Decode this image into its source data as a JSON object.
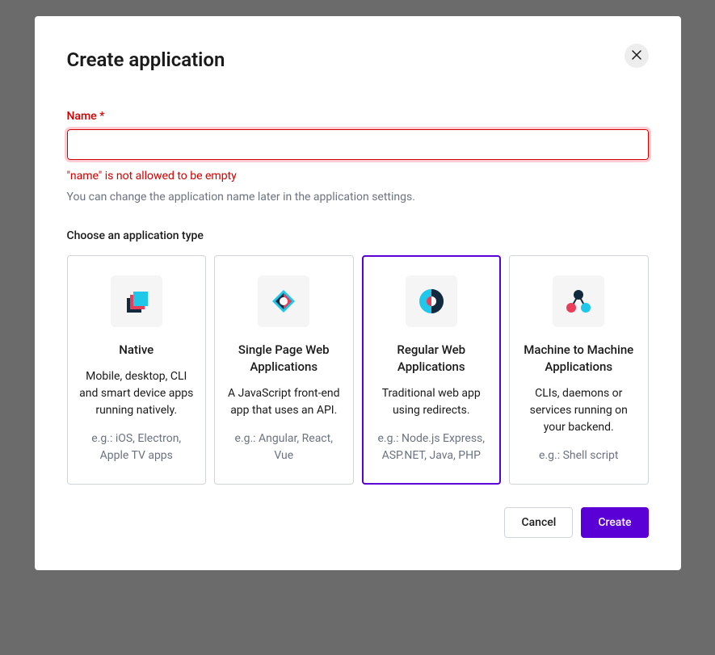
{
  "modal": {
    "title": "Create application",
    "name_field": {
      "label": "Name *",
      "value": "",
      "error": "\"name\" is not allowed to be empty",
      "help": "You can change the application name later in the application settings."
    },
    "type_section": {
      "label": "Choose an application type",
      "options": [
        {
          "title": "Native",
          "description": "Mobile, desktop, CLI and smart device apps running natively.",
          "example": "e.g.: iOS, Electron, Apple TV apps",
          "selected": false,
          "icon": "native"
        },
        {
          "title": "Single Page Web Applications",
          "description": "A JavaScript front-end app that uses an API.",
          "example": "e.g.: Angular, React, Vue",
          "selected": false,
          "icon": "spa"
        },
        {
          "title": "Regular Web Applications",
          "description": "Traditional web app using redirects.",
          "example": "e.g.: Node.js Express, ASP.NET, Java, PHP",
          "selected": true,
          "icon": "regular"
        },
        {
          "title": "Machine to Machine Applications",
          "description": "CLIs, daemons or services running on your backend.",
          "example": "e.g.: Shell script",
          "selected": false,
          "icon": "m2m"
        }
      ]
    },
    "actions": {
      "cancel": "Cancel",
      "create": "Create"
    }
  }
}
